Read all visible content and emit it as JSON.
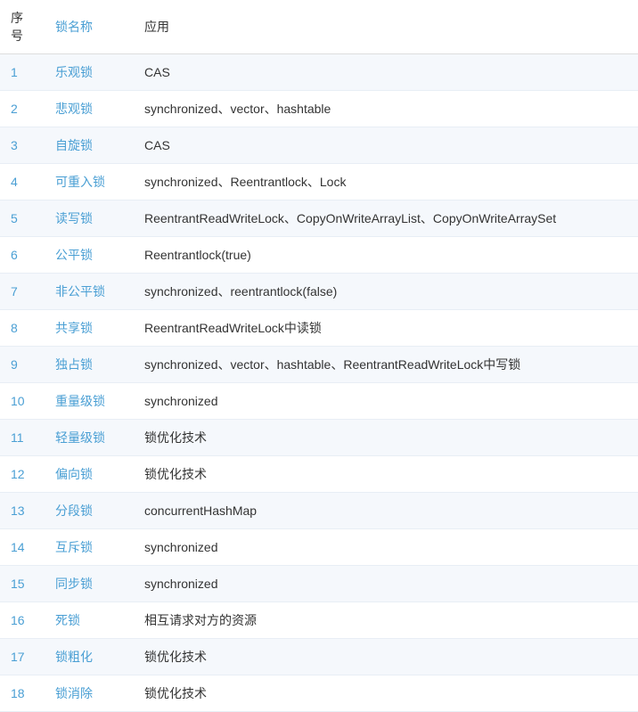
{
  "table": {
    "headers": [
      {
        "id": "index",
        "label": "序号"
      },
      {
        "id": "name",
        "label": "锁名称"
      },
      {
        "id": "app",
        "label": "应用"
      }
    ],
    "rows": [
      {
        "index": "1",
        "name": "乐观锁",
        "app": "CAS"
      },
      {
        "index": "2",
        "name": "悲观锁",
        "app": "synchronized、vector、hashtable"
      },
      {
        "index": "3",
        "name": "自旋锁",
        "app": "CAS"
      },
      {
        "index": "4",
        "name": "可重入锁",
        "app": "synchronized、Reentrantlock、Lock"
      },
      {
        "index": "5",
        "name": "读写锁",
        "app": "ReentrantReadWriteLock、CopyOnWriteArrayList、CopyOnWriteArraySet"
      },
      {
        "index": "6",
        "name": "公平锁",
        "app": "Reentrantlock(true)"
      },
      {
        "index": "7",
        "name": "非公平锁",
        "app": "synchronized、reentrantlock(false)"
      },
      {
        "index": "8",
        "name": "共享锁",
        "app": "ReentrantReadWriteLock中读锁"
      },
      {
        "index": "9",
        "name": "独占锁",
        "app": "synchronized、vector、hashtable、ReentrantReadWriteLock中写锁"
      },
      {
        "index": "10",
        "name": "重量级锁",
        "app": "synchronized"
      },
      {
        "index": "11",
        "name": "轻量级锁",
        "app": "锁优化技术"
      },
      {
        "index": "12",
        "name": "偏向锁",
        "app": "锁优化技术"
      },
      {
        "index": "13",
        "name": "分段锁",
        "app": "concurrentHashMap"
      },
      {
        "index": "14",
        "name": "互斥锁",
        "app": "synchronized"
      },
      {
        "index": "15",
        "name": "同步锁",
        "app": "synchronized"
      },
      {
        "index": "16",
        "name": "死锁",
        "app": "相互请求对方的资源"
      },
      {
        "index": "17",
        "name": "锁粗化",
        "app": "锁优化技术"
      },
      {
        "index": "18",
        "name": "锁消除",
        "app": "锁优化技术"
      }
    ]
  }
}
